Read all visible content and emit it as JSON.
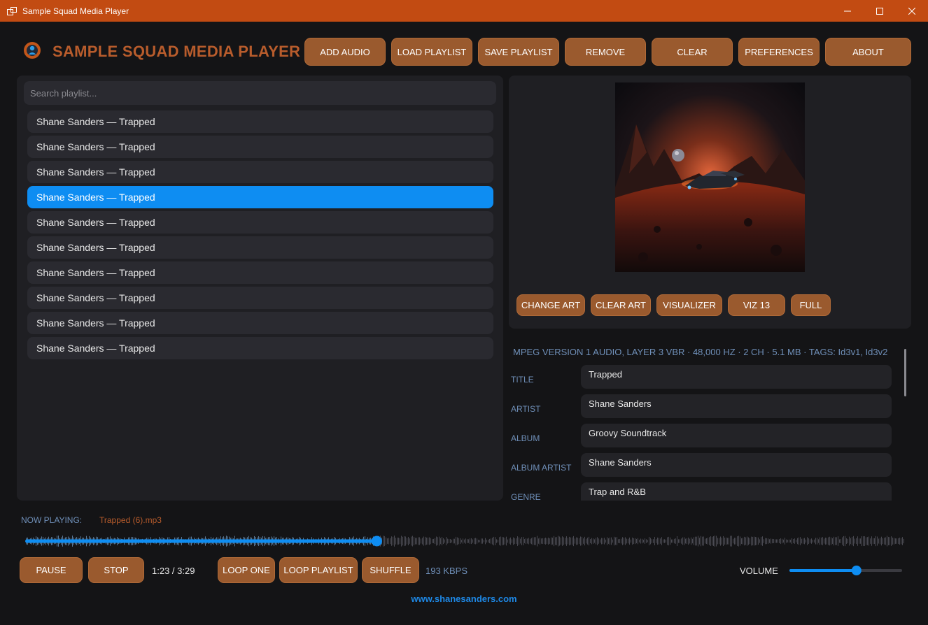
{
  "window": {
    "title": "Sample Squad Media Player",
    "accent_color": "#c24b12"
  },
  "header": {
    "brand": "SAMPLE SQUAD MEDIA PLAYER",
    "buttons": [
      "ADD AUDIO",
      "LOAD PLAYLIST",
      "SAVE PLAYLIST",
      "REMOVE",
      "CLEAR",
      "PREFERENCES",
      "ABOUT"
    ]
  },
  "playlist": {
    "search_placeholder": "Search playlist...",
    "items": [
      "Shane Sanders — Trapped",
      "Shane Sanders — Trapped",
      "Shane Sanders — Trapped",
      "Shane Sanders — Trapped",
      "Shane Sanders — Trapped",
      "Shane Sanders — Trapped",
      "Shane Sanders — Trapped",
      "Shane Sanders — Trapped",
      "Shane Sanders — Trapped",
      "Shane Sanders — Trapped"
    ],
    "selected_index": 3,
    "selected_color": "#0e8df2"
  },
  "art": {
    "buttons": [
      "CHANGE ART",
      "CLEAR ART",
      "VISUALIZER",
      "VIZ 13",
      "FULL"
    ]
  },
  "metadata": {
    "info": "MPEG VERSION 1 AUDIO, LAYER 3 VBR · 48,000 HZ · 2 CH · 5.1 MB · TAGS: Id3v1, Id3v2",
    "fields": [
      {
        "label": "TITLE",
        "value": "Trapped"
      },
      {
        "label": "ARTIST",
        "value": "Shane Sanders"
      },
      {
        "label": "ALBUM",
        "value": "Groovy Soundtrack"
      },
      {
        "label": "ALBUM ARTIST",
        "value": "Shane Sanders"
      },
      {
        "label": "GENRE",
        "value": "Trap and R&B"
      }
    ]
  },
  "now_playing": {
    "label": "NOW PLAYING:",
    "file": "Trapped (6).mp3",
    "progress": 0.4
  },
  "transport": {
    "pause": "PAUSE",
    "stop": "STOP",
    "time": "1:23 / 3:29",
    "loop_one": "LOOP ONE",
    "loop_playlist": "LOOP PLAYLIST",
    "shuffle": "SHUFFLE",
    "bitrate": "193 KBPS",
    "volume_label": "VOLUME",
    "volume_level": 0.6
  },
  "footer": {
    "link": "www.shanesanders.com"
  },
  "icons": {
    "app": "app-window-icon",
    "logo": "sample-squad-logo-icon",
    "minimize": "minimize-icon",
    "maximize": "maximize-icon",
    "close": "close-icon"
  }
}
